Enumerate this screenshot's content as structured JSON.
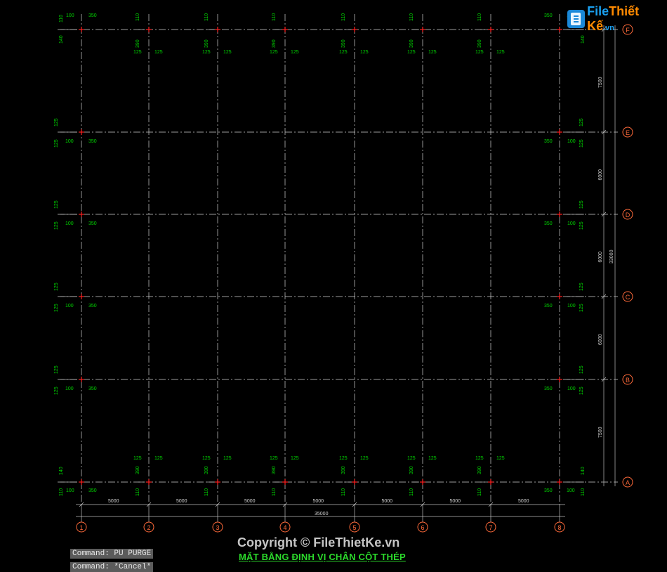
{
  "logo": {
    "part1": "File",
    "part2": "Thiết Kế",
    "part3": ".vn"
  },
  "copyright": "Copyright © FileThietKe.vn",
  "drawing_title": "MẶT BẰNG ĐỊNH VỊ CHÂN CỘT THÉP",
  "command_line": {
    "line1": "Command: PU PURGE",
    "line2": "Command: *Cancel*"
  },
  "axes": {
    "vertical": [
      "1",
      "2",
      "3",
      "4",
      "5",
      "6",
      "7",
      "8"
    ],
    "horizontal": [
      "F",
      "E",
      "D",
      "C",
      "B",
      "A"
    ]
  },
  "dimensions": {
    "bottom_spans": [
      "5000",
      "5000",
      "5000",
      "5000",
      "5000",
      "5000",
      "5000"
    ],
    "bottom_total": "35000",
    "right_spans": [
      "7500",
      "6000",
      "6000",
      "6000",
      "7500"
    ],
    "right_total": "33000"
  },
  "column_labels": {
    "interior_top": {
      "a": "110",
      "b": "390",
      "c": "125",
      "d": "125"
    },
    "interior_bottom": {
      "a": "125",
      "b": "125",
      "c": "390",
      "d": "110"
    },
    "corner": {
      "a": "110",
      "b": "100",
      "c": "350",
      "d": "140"
    },
    "edge": {
      "a": "125",
      "b": "125",
      "c": "100",
      "d": "350"
    }
  },
  "colors": {
    "background": "#000000",
    "grid": "#d0d0d0",
    "dimension_text": "#00d200",
    "axis_bubble": "#ff6a3a",
    "column_mark": "#ff2020",
    "title": "#2bd92b"
  }
}
